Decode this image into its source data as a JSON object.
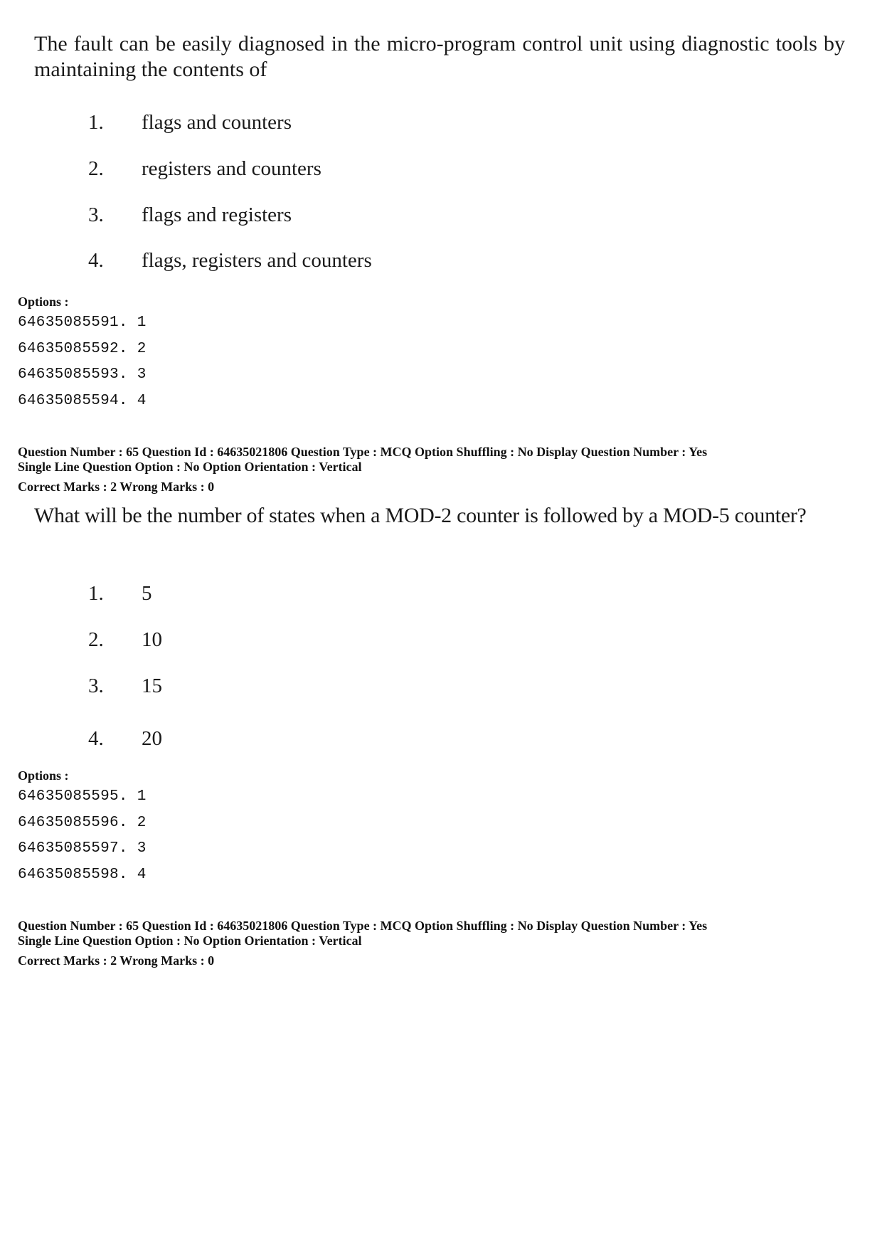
{
  "question_block_1": {
    "question_text": "The fault can be easily diagnosed in the micro-program control unit using diagnostic tools by maintaining the contents of",
    "choices": [
      {
        "num": "1.",
        "text": "flags and counters"
      },
      {
        "num": "2.",
        "text": "registers and counters"
      },
      {
        "num": "3.",
        "text": "flags and registers"
      },
      {
        "num": "4.",
        "text": "flags, registers and counters"
      }
    ],
    "options_label": "Options :",
    "options": [
      "64635085591. 1",
      "64635085592. 2",
      "64635085593. 3",
      "64635085594. 4"
    ]
  },
  "meta_block_1": {
    "line1": "Question Number : 65  Question Id : 64635021806  Question Type : MCQ  Option Shuffling : No  Display Question Number : Yes",
    "line2": "Single Line Question Option : No  Option Orientation : Vertical",
    "line3": "Correct Marks : 2  Wrong Marks : 0"
  },
  "question_block_2": {
    "question_text": "What will be the number of states when a MOD-2 counter is followed by a MOD-5 counter?",
    "choices": [
      {
        "num": "1.",
        "text": "5"
      },
      {
        "num": "2.",
        "text": "10"
      },
      {
        "num": "3.",
        "text": "15"
      },
      {
        "num": "4.",
        "text": "20"
      }
    ],
    "options_label": "Options :",
    "options": [
      "64635085595. 1",
      "64635085596. 2",
      "64635085597. 3",
      "64635085598. 4"
    ]
  },
  "meta_block_2": {
    "line1": "Question Number : 65  Question Id : 64635021806  Question Type : MCQ  Option Shuffling : No  Display Question Number : Yes",
    "line2": "Single Line Question Option : No  Option Orientation : Vertical",
    "line3": "Correct Marks : 2  Wrong Marks : 0"
  }
}
